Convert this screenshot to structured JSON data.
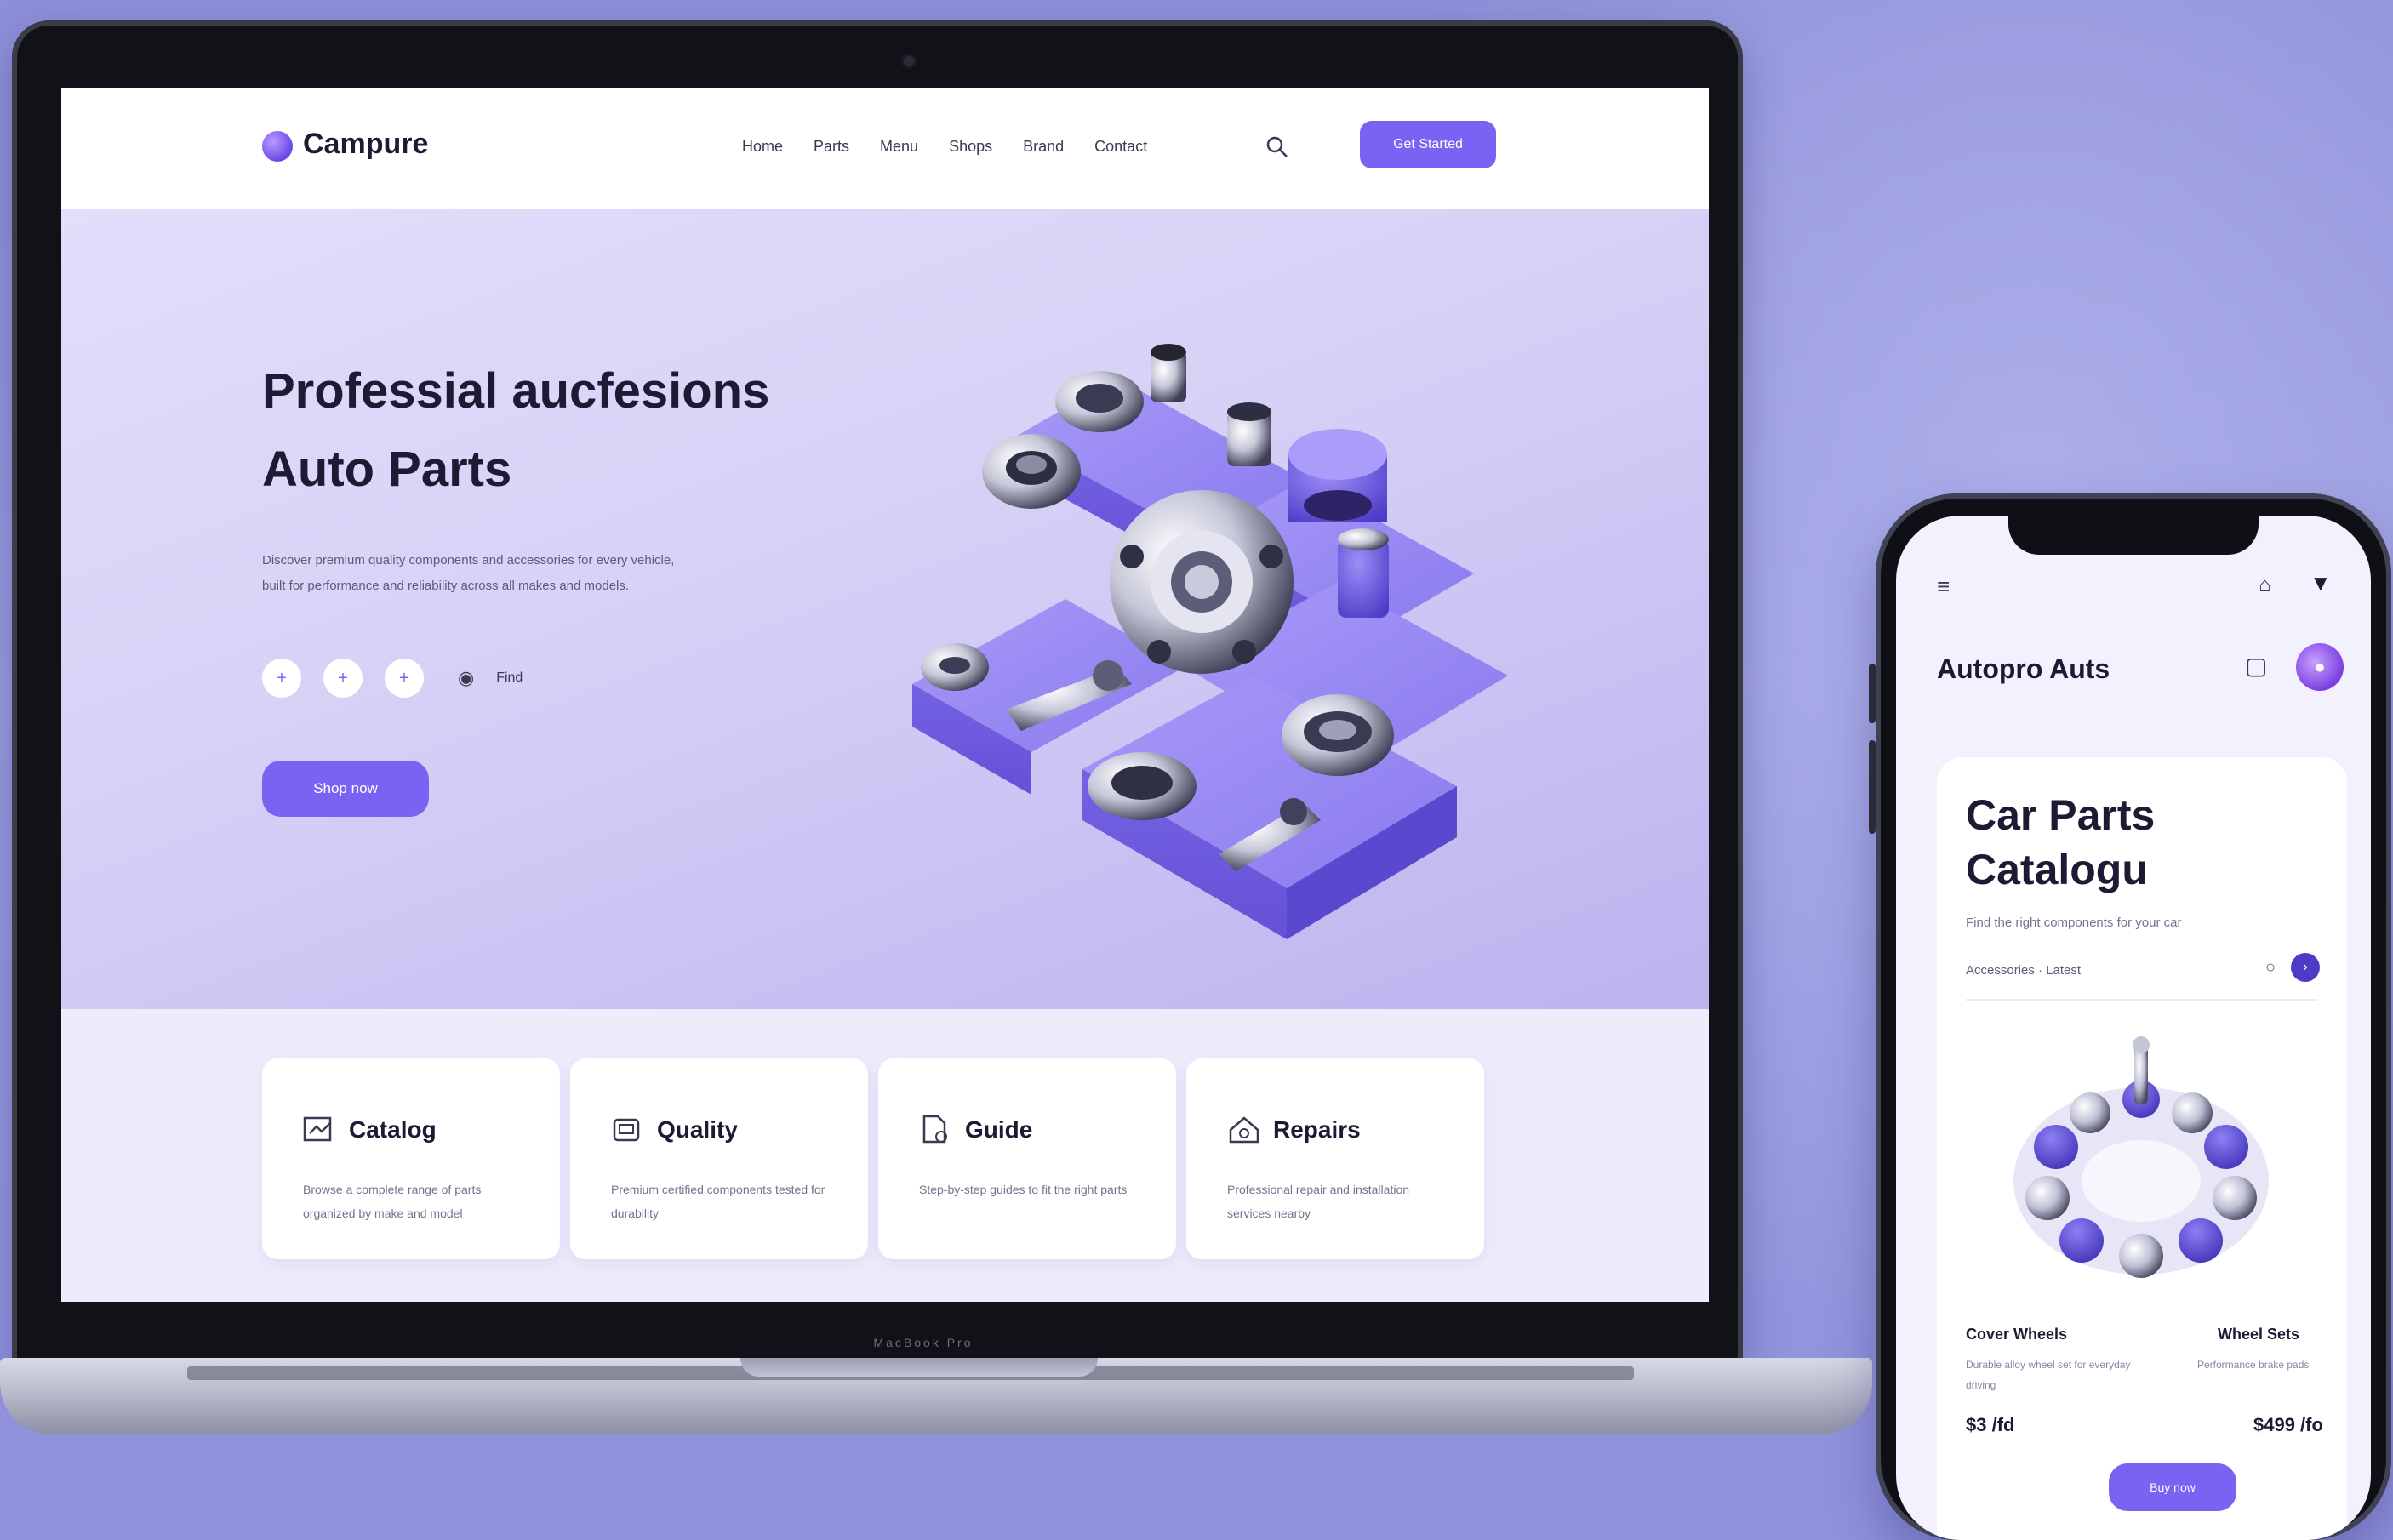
{
  "site": {
    "logo_text": "Campure",
    "nav": [
      "Home",
      "Parts",
      "Menu",
      "Shops",
      "Brand",
      "Contact"
    ],
    "cta_top": "Get Started",
    "hero": {
      "title_line1": "Professial aucfesions",
      "title_line2": "Auto Parts",
      "description": "Discover premium quality components and accessories for every vehicle, built for performance and reliability across all makes and models.",
      "location_label": "Find",
      "cta": "Shop now",
      "dots": [
        "+",
        "+",
        "+"
      ]
    },
    "features": [
      {
        "title": "Catalog",
        "icon": "catalog-icon",
        "desc": "Browse a complete range of parts organized by make and model"
      },
      {
        "title": "Quality",
        "icon": "engine-icon",
        "desc": "Premium certified components tested for durability"
      },
      {
        "title": "Guide",
        "icon": "document-icon",
        "desc": "Step-by-step guides to fit the right parts"
      },
      {
        "title": "Repairs",
        "icon": "home-service-icon",
        "desc": "Professional repair and installation services nearby"
      }
    ],
    "keyboard_label": "MacBook Pro"
  },
  "phone": {
    "app_title": "Autopro Auts",
    "card_title": "Car Parts Catalogu",
    "card_subtitle": "Find the right components for your car",
    "filter_label": "Accessories · Latest",
    "product_left_name": "Cover Wheels",
    "product_left_desc": "Durable alloy wheel set for everyday driving",
    "product_left_price": "$3 /fd",
    "product_right_name": "Wheel Sets",
    "product_right_desc": "Performance brake pads",
    "product_right_price": "$499 /fo",
    "cta": "Buy now"
  },
  "colors": {
    "accent": "#7b62f2",
    "background": "#8d8fd8",
    "hero_bg": "#d6d0f6"
  }
}
